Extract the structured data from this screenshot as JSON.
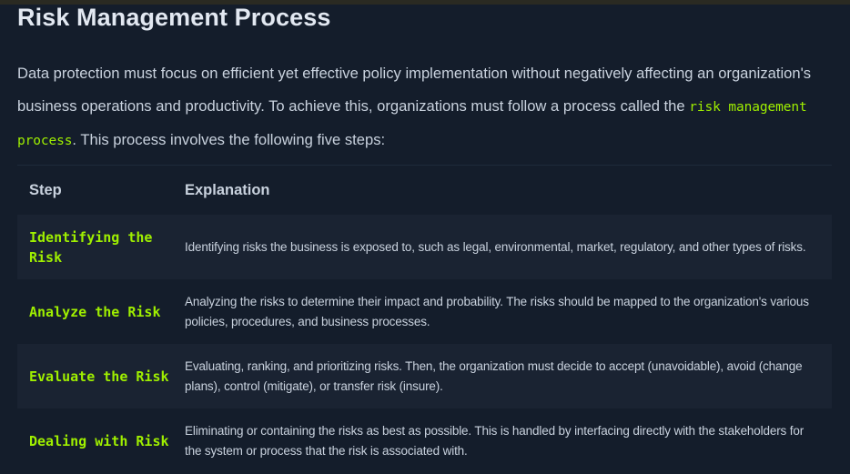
{
  "title": "Risk Management Process",
  "intro": {
    "text_before": "Data protection must focus on efficient yet effective policy implementation without negatively affecting an organization's business operations and productivity. To achieve this, organizations must follow a process called the ",
    "code": "risk management process",
    "text_after": ". This process involves the following five steps:"
  },
  "table": {
    "headers": [
      "Step",
      "Explanation"
    ],
    "rows": [
      {
        "step": "Identifying the Risk",
        "explanation": "Identifying risks the business is exposed to, such as legal, environmental, market, regulatory, and other types of risks."
      },
      {
        "step": "Analyze the Risk",
        "explanation": "Analyzing the risks to determine their impact and probability. The risks should be mapped to the organization's various policies, procedures, and business processes."
      },
      {
        "step": "Evaluate the Risk",
        "explanation": "Evaluating, ranking, and prioritizing risks. Then, the organization must decide to accept (unavoidable), avoid (change plans), control (mitigate), or transfer risk (insure)."
      },
      {
        "step": "Dealing with Risk",
        "explanation": "Eliminating or containing the risks as best as possible. This is handled by interfacing directly with the stakeholders for the system or process that the risk is associated with."
      }
    ]
  },
  "colors": {
    "background": "#141d2b",
    "row_alt": "#1a2332",
    "accent_green": "#9fef00",
    "text": "#c9d2de"
  }
}
